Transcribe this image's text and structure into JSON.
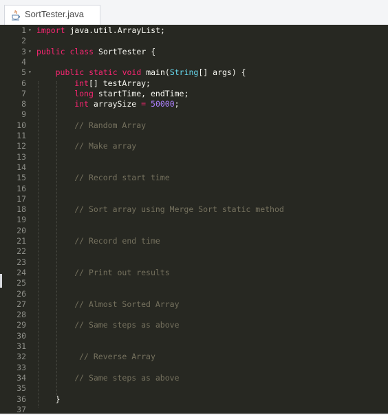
{
  "tab": {
    "icon": "java-coffee-icon",
    "label": "SortTester.java"
  },
  "lines": [
    {
      "n": "1",
      "fold": true,
      "indent": 0,
      "parts": [
        {
          "t": "import",
          "c": "kw"
        },
        {
          "t": " java.util.ArrayList;",
          "c": ""
        }
      ]
    },
    {
      "n": "2",
      "fold": false,
      "indent": 0,
      "parts": []
    },
    {
      "n": "3",
      "fold": true,
      "indent": 0,
      "parts": [
        {
          "t": "public",
          "c": "kw"
        },
        {
          "t": " ",
          "c": ""
        },
        {
          "t": "class",
          "c": "kw"
        },
        {
          "t": " SortTester {",
          "c": ""
        }
      ]
    },
    {
      "n": "4",
      "fold": false,
      "indent": 0,
      "parts": []
    },
    {
      "n": "5",
      "fold": true,
      "indent": 4,
      "parts": [
        {
          "t": "public",
          "c": "kw"
        },
        {
          "t": " ",
          "c": ""
        },
        {
          "t": "static",
          "c": "kw"
        },
        {
          "t": " ",
          "c": ""
        },
        {
          "t": "void",
          "c": "kw"
        },
        {
          "t": " main(",
          "c": ""
        },
        {
          "t": "String",
          "c": "ty"
        },
        {
          "t": "[] args) {",
          "c": ""
        }
      ]
    },
    {
      "n": "6",
      "fold": false,
      "indent": 8,
      "parts": [
        {
          "t": "int",
          "c": "kw"
        },
        {
          "t": "[] testArray;",
          "c": ""
        }
      ]
    },
    {
      "n": "7",
      "fold": false,
      "indent": 8,
      "parts": [
        {
          "t": "long",
          "c": "kw"
        },
        {
          "t": " startTime, endTime;",
          "c": ""
        }
      ]
    },
    {
      "n": "8",
      "fold": false,
      "indent": 8,
      "parts": [
        {
          "t": "int",
          "c": "kw"
        },
        {
          "t": " arraySize ",
          "c": ""
        },
        {
          "t": "=",
          "c": "kw"
        },
        {
          "t": " ",
          "c": ""
        },
        {
          "t": "50000",
          "c": "nm"
        },
        {
          "t": ";",
          "c": ""
        }
      ]
    },
    {
      "n": "9",
      "fold": false,
      "indent": 0,
      "parts": []
    },
    {
      "n": "10",
      "fold": false,
      "indent": 8,
      "parts": [
        {
          "t": "// Random Array",
          "c": "cm"
        }
      ]
    },
    {
      "n": "11",
      "fold": false,
      "indent": 0,
      "parts": []
    },
    {
      "n": "12",
      "fold": false,
      "indent": 8,
      "parts": [
        {
          "t": "// Make array",
          "c": "cm"
        }
      ]
    },
    {
      "n": "13",
      "fold": false,
      "indent": 0,
      "parts": []
    },
    {
      "n": "14",
      "fold": false,
      "indent": 0,
      "parts": []
    },
    {
      "n": "15",
      "fold": false,
      "indent": 8,
      "parts": [
        {
          "t": "// Record start time",
          "c": "cm"
        }
      ]
    },
    {
      "n": "16",
      "fold": false,
      "indent": 0,
      "parts": []
    },
    {
      "n": "17",
      "fold": false,
      "indent": 0,
      "parts": []
    },
    {
      "n": "18",
      "fold": false,
      "indent": 8,
      "parts": [
        {
          "t": "// Sort array using Merge Sort static method",
          "c": "cm"
        }
      ]
    },
    {
      "n": "19",
      "fold": false,
      "indent": 0,
      "parts": []
    },
    {
      "n": "20",
      "fold": false,
      "indent": 0,
      "parts": []
    },
    {
      "n": "21",
      "fold": false,
      "indent": 8,
      "parts": [
        {
          "t": "// Record end time",
          "c": "cm"
        }
      ]
    },
    {
      "n": "22",
      "fold": false,
      "indent": 0,
      "parts": []
    },
    {
      "n": "23",
      "fold": false,
      "indent": 0,
      "parts": []
    },
    {
      "n": "24",
      "fold": false,
      "indent": 8,
      "parts": [
        {
          "t": "// Print out results",
          "c": "cm"
        }
      ]
    },
    {
      "n": "25",
      "fold": false,
      "indent": 0,
      "parts": []
    },
    {
      "n": "26",
      "fold": false,
      "indent": 0,
      "parts": []
    },
    {
      "n": "27",
      "fold": false,
      "indent": 8,
      "parts": [
        {
          "t": "// Almost Sorted Array",
          "c": "cm"
        }
      ]
    },
    {
      "n": "28",
      "fold": false,
      "indent": 0,
      "parts": []
    },
    {
      "n": "29",
      "fold": false,
      "indent": 8,
      "parts": [
        {
          "t": "// Same steps as above",
          "c": "cm"
        }
      ]
    },
    {
      "n": "30",
      "fold": false,
      "indent": 0,
      "parts": []
    },
    {
      "n": "31",
      "fold": false,
      "indent": 0,
      "parts": []
    },
    {
      "n": "32",
      "fold": false,
      "indent": 9,
      "parts": [
        {
          "t": "// Reverse Array",
          "c": "cm"
        }
      ]
    },
    {
      "n": "33",
      "fold": false,
      "indent": 0,
      "parts": []
    },
    {
      "n": "34",
      "fold": false,
      "indent": 8,
      "parts": [
        {
          "t": "// Same steps as above",
          "c": "cm"
        }
      ]
    },
    {
      "n": "35",
      "fold": false,
      "indent": 0,
      "parts": []
    },
    {
      "n": "36",
      "fold": false,
      "indent": 4,
      "parts": [
        {
          "t": "}",
          "c": ""
        }
      ]
    },
    {
      "n": "37",
      "fold": false,
      "indent": 0,
      "parts": []
    }
  ],
  "colors": {
    "editor_bg": "#272822",
    "keyword": "#f92672",
    "type": "#66d9ef",
    "number": "#ae81ff",
    "comment": "#75715e",
    "text": "#f8f8f2",
    "line_number": "#8f908a"
  }
}
